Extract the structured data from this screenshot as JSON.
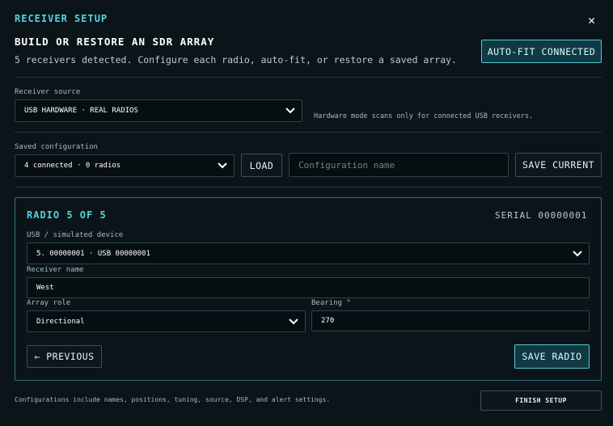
{
  "dialog": {
    "title": "RECEIVER SETUP",
    "close_icon": "close-icon",
    "heading": "BUILD OR RESTORE AN SDR ARRAY",
    "description": "5 receivers detected. Configure each radio, auto-fit, or restore a saved array.",
    "auto_fit_label": "AUTO-FIT CONNECTED"
  },
  "source": {
    "label": "Receiver source",
    "value": "USB HARDWARE · REAL RADIOS",
    "note": "Hardware mode scans only for connected USB receivers."
  },
  "saved": {
    "label": "Saved configuration",
    "value": "4 connected · 0 radios",
    "load_label": "LOAD",
    "name_placeholder": "Configuration name",
    "save_current_label": "SAVE CURRENT"
  },
  "radio": {
    "title": "RADIO 5 OF 5",
    "serial": "SERIAL 00000001",
    "device_label": "USB / simulated device",
    "device_value": "5. 00000001 · USB 00000001",
    "name_label": "Receiver name",
    "name_value": "West",
    "role_label": "Array role",
    "role_value": "Directional",
    "bearing_label": "Bearing °",
    "bearing_value": "270",
    "previous_label": "← PREVIOUS",
    "save_radio_label": "SAVE RADIO"
  },
  "footer": {
    "note": "Configurations include names, positions, tuning, source, DSP, and alert settings.",
    "finish_label": "FINISH SETUP"
  },
  "colors": {
    "background": "#0a1419",
    "accent": "#56d3e0",
    "accent_button_bg": "#0f3a44",
    "border": "#2e444b"
  }
}
